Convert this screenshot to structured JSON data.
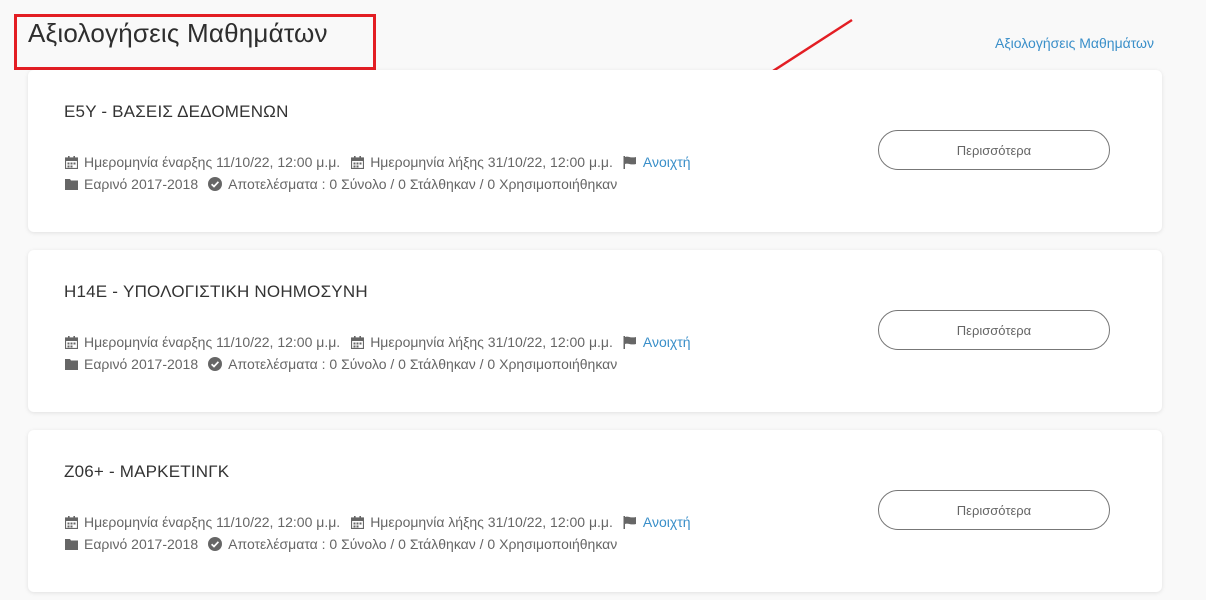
{
  "header": {
    "title": "Αξιολογήσεις Μαθημάτων",
    "breadcrumb": "Αξιολογήσεις Μαθημάτων"
  },
  "annotation": {
    "highlight_color": "#e31e24",
    "arrow_color": "#e31e24"
  },
  "courses": [
    {
      "title": "E5Y - ΒΑΣΕΙΣ ΔΕΔΟΜΕΝΩΝ",
      "start_label": "Ημερομηνία έναρξης 11/10/22, 12:00 μ.μ.",
      "end_label": "Ημερομηνία λήξης 31/10/22, 12:00 μ.μ.",
      "status": "Ανοιχτή",
      "semester": "Εαρινό 2017-2018",
      "results": "Αποτελέσματα : 0 Σύνολο / 0 Στάλθηκαν / 0 Χρησιμοποιήθηκαν",
      "button": "Περισσότερα"
    },
    {
      "title": "H14E - ΥΠΟΛΟΓΙΣΤΙΚΗ ΝΟΗΜΟΣΥΝΗ",
      "start_label": "Ημερομηνία έναρξης 11/10/22, 12:00 μ.μ.",
      "end_label": "Ημερομηνία λήξης 31/10/22, 12:00 μ.μ.",
      "status": "Ανοιχτή",
      "semester": "Εαρινό 2017-2018",
      "results": "Αποτελέσματα : 0 Σύνολο / 0 Στάλθηκαν / 0 Χρησιμοποιήθηκαν",
      "button": "Περισσότερα"
    },
    {
      "title": "Z06+ - ΜΑΡΚΕΤΙΝΓΚ",
      "start_label": "Ημερομηνία έναρξης 11/10/22, 12:00 μ.μ.",
      "end_label": "Ημερομηνία λήξης 31/10/22, 12:00 μ.μ.",
      "status": "Ανοιχτή",
      "semester": "Εαρινό 2017-2018",
      "results": "Αποτελέσματα : 0 Σύνολο / 0 Στάλθηκαν / 0 Χρησιμοποιήθηκαν",
      "button": "Περισσότερα"
    }
  ],
  "icons": {
    "start": "calendar-icon",
    "end": "calendar-icon",
    "status": "flag-icon",
    "semester": "folder-icon",
    "results": "check-circle-icon"
  }
}
